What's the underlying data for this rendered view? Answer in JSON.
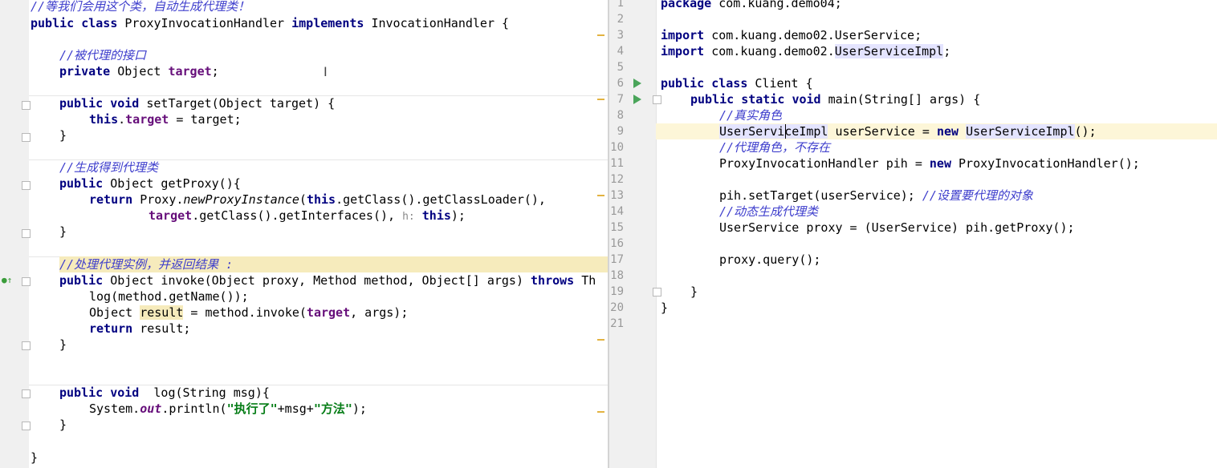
{
  "left": {
    "l1_comment": "//等我们会用这个类，自动生成代理类！",
    "l2": {
      "kw1": "public",
      "kw2": "class",
      "name": " ProxyInvocationHandler ",
      "kw3": "implements",
      "rest": " InvocationHandler {"
    },
    "l4_comment": "//被代理的接口",
    "l5": {
      "kw": "private",
      "type": " Object ",
      "field": "target",
      "rest": ";"
    },
    "l7": {
      "kw1": "public",
      "kw2": "void",
      "rest": " setTarget(Object target) {"
    },
    "l8": {
      "kw": "this",
      "dot": ".",
      "field": "target",
      "rest": " = target;"
    },
    "brace": "}",
    "l11_comment": "//生成得到代理类",
    "l12": {
      "kw": "public",
      "rest": " Object getProxy(){"
    },
    "l13": {
      "kw": "return",
      "a": " Proxy.",
      "m": "newProxyInstance",
      "b": "(",
      "kw2": "this",
      "c": ".getClass().getClassLoader(),"
    },
    "l14": {
      "field": "target",
      "a": ".getClass().getInterfaces(), ",
      "hint": "h:",
      "sp": " ",
      "kw": "this",
      "b": ");"
    },
    "l16_comment": "//处理代理实例，并返回结果 :",
    "l17": {
      "kw": "public",
      "a": " Object invoke(Object proxy, Method method, Object[] args) ",
      "kw2": "throws",
      "b": " Th"
    },
    "l18": "log(method.getName());",
    "l19": {
      "a": "Object ",
      "var": "result",
      "b": " = method.invoke(",
      "field": "target",
      "c": ", args);"
    },
    "l20": {
      "kw": "return",
      "rest": " result;"
    },
    "l24": {
      "kw1": "public",
      "kw2": "void",
      "rest": "  log(String msg){"
    },
    "l25": {
      "a": "System.",
      "st": "out",
      "b": ".println(",
      "s1": "\"执行了\"",
      "c": "+msg+",
      "s2": "\"方法\"",
      "d": ");"
    },
    "ibeam": "I"
  },
  "right": {
    "line_numbers": [
      "1",
      "2",
      "3",
      "4",
      "5",
      "6",
      "7",
      "8",
      "9",
      "10",
      "11",
      "12",
      "13",
      "14",
      "15",
      "16",
      "17",
      "18",
      "19",
      "20",
      "21"
    ],
    "r1": {
      "kw": "package",
      "rest": " com.kuang.demo04;"
    },
    "r3": {
      "kw": "import",
      "rest": " com.kuang.demo02.UserService;"
    },
    "r4": {
      "kw": "import",
      "a": " com.kuang.demo02.",
      "hl": "UserServiceImpl",
      "b": ";"
    },
    "r6": {
      "kw1": "public",
      "kw2": "class",
      "rest": " Client {"
    },
    "r7": {
      "kw1": "public",
      "kw2": "static",
      "kw3": "void",
      "rest": " main(String[] args) {"
    },
    "r8_comment": "//真实角色",
    "r9": {
      "hl1": "UserServiceImpl",
      "a": " userService = ",
      "kw": "new",
      "b": " ",
      "hl2": "UserServiceImpl",
      "c": "();"
    },
    "r10_comment": "//代理角色，不存在",
    "r11": {
      "a": "ProxyInvocationHandler pih = ",
      "kw": "new",
      "b": " ProxyInvocationHandler();"
    },
    "r13": {
      "a": "pih.setTarget(userService); ",
      "cm": "//设置要代理的对象"
    },
    "r14_comment": "//动态生成代理类",
    "r15": "UserService proxy = (UserService) pih.getProxy();",
    "r17": "proxy.query();",
    "r19": "}",
    "r20": "}"
  },
  "colors": {
    "keyword": "#000080",
    "comment": "#3d3dcc",
    "field": "#660e7a",
    "string": "#067d17",
    "highlight": "#e4e4ff",
    "current_line": "#fdf6d8"
  },
  "icons": [
    "run-gutter-icon",
    "fold-icon",
    "override-gutter-icon",
    "warning-marker"
  ]
}
